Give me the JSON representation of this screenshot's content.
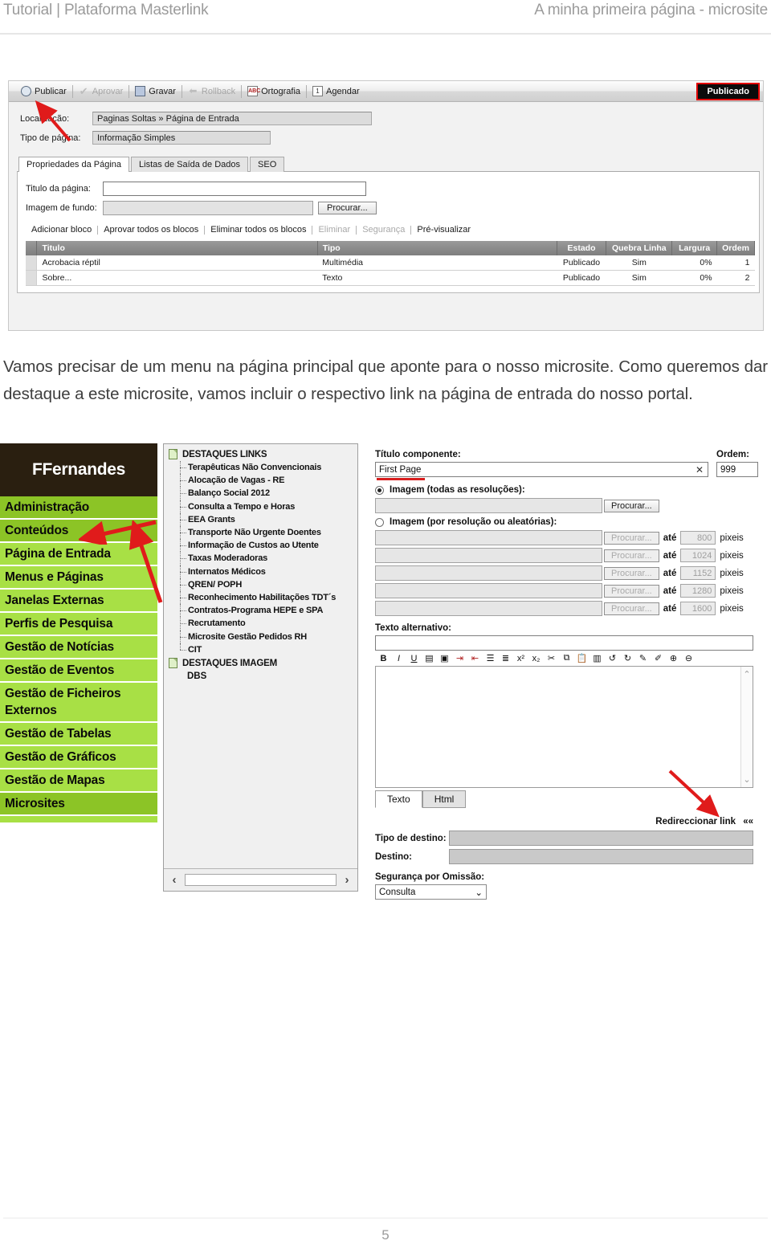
{
  "header": {
    "left": "Tutorial | Plataforma Masterlink",
    "right": "A minha primeira página - microsite"
  },
  "screenshot1": {
    "toolbar": {
      "publicar": "Publicar",
      "aprovar": "Aprovar",
      "gravar": "Gravar",
      "rollback": "Rollback",
      "ortografia": "Ortografia",
      "agendar": "Agendar",
      "status_badge": "Publicado",
      "status_badge_border": "#e20000"
    },
    "fields": {
      "localizacao_label": "Localização:",
      "localizacao_value": "Paginas Soltas » Página de Entrada",
      "tipo_pagina_label": "Tipo de página:",
      "tipo_pagina_value": "Informação Simples"
    },
    "tabs": [
      {
        "label": "Propriedades da Página",
        "active": true
      },
      {
        "label": "Listas de Saída de Dados",
        "active": false
      },
      {
        "label": "SEO",
        "active": false
      }
    ],
    "panel": {
      "titulo_label": "Titulo da página:",
      "titulo_value": "",
      "imagem_label": "Imagem de fundo:",
      "imagem_value": "",
      "procurar_label": "Procurar..."
    },
    "block_actions": [
      {
        "label": "Adicionar bloco",
        "dim": false
      },
      {
        "label": "Aprovar todos os blocos",
        "dim": false
      },
      {
        "label": "Eliminar todos os blocos",
        "dim": false
      },
      {
        "label": "Eliminar",
        "dim": true
      },
      {
        "label": "Segurança",
        "dim": true
      },
      {
        "label": "Pré-visualizar",
        "dim": false
      }
    ],
    "table": {
      "columns": [
        "Titulo",
        "Tipo",
        "Estado",
        "Quebra Linha",
        "Largura",
        "Ordem"
      ],
      "rows": [
        {
          "titulo": "Acrobacia réptil",
          "tipo": "Multimédia",
          "estado": "Publicado",
          "quebra": "Sim",
          "largura": "0%",
          "ordem": "1"
        },
        {
          "titulo": "Sobre...",
          "tipo": "Texto",
          "estado": "Publicado",
          "quebra": "Sim",
          "largura": "0%",
          "ordem": "2"
        }
      ]
    }
  },
  "paragraph": "Vamos precisar de um menu na página principal que aponte para o nosso microsite. Como queremos dar destaque a este microsite, vamos incluir o respectivo link na página de entrada do nosso portal.",
  "screenshot2": {
    "sidebar": {
      "user": "FFernandes",
      "header_color": "#2a1f10",
      "item_color": "#a8e045",
      "active_color": "#8cc426",
      "items": [
        {
          "label": "Administração",
          "active": true
        },
        {
          "label": "Conteúdos",
          "active": true
        },
        {
          "label": "Página de Entrada",
          "active": false
        },
        {
          "label": "Menus e Páginas",
          "active": false
        },
        {
          "label": "Janelas Externas",
          "active": false
        },
        {
          "label": "Perfis de Pesquisa",
          "active": false
        },
        {
          "label": "Gestão de Notícias",
          "active": false
        },
        {
          "label": "Gestão de Eventos",
          "active": false
        },
        {
          "label": "Gestão de Ficheiros Externos",
          "active": false
        },
        {
          "label": "Gestão de Tabelas",
          "active": false
        },
        {
          "label": "Gestão de Gráficos",
          "active": false
        },
        {
          "label": "Gestão de Mapas",
          "active": false
        },
        {
          "label": "Microsites",
          "active": true
        }
      ]
    },
    "tree": {
      "root": "DESTAQUES LINKS",
      "children": [
        "Terapêuticas Não Convencionais",
        "Alocação de Vagas - RE",
        "Balanço Social 2012",
        "Consulta a Tempo e Horas",
        "EEA Grants",
        "Transporte Não Urgente Doentes",
        "Informação de Custos ao Utente",
        "Taxas Moderadoras",
        "Internatos Médicos",
        "QREN/ POPH",
        "Reconhecimento Habilitações TDT´s",
        "Contratos-Programa HEPE e SPA",
        "Recrutamento",
        "Microsite Gestão Pedidos RH",
        "CIT"
      ],
      "root2": "DESTAQUES IMAGEM",
      "extra": "DBS",
      "scroll_prev": "‹",
      "scroll_next": "›"
    },
    "form": {
      "titulo_componente_label": "Título componente:",
      "titulo_componente_value": "First Page",
      "clear_icon": "✕",
      "ordem_label": "Ordem:",
      "ordem_value": "999",
      "radio_all_label": "Imagem (todas as resoluções):",
      "radio_res_label": "Imagem (por resolução ou aleatórias):",
      "procurar_label": "Procurar...",
      "ate_label": "até",
      "pixeis_label": "pixeis",
      "resolutions": [
        "800",
        "1024",
        "1152",
        "1280",
        "1600"
      ],
      "texto_alternativo_label": "Texto alternativo:",
      "texto_alternativo_value": "",
      "editor_tabs": [
        {
          "label": "Texto",
          "active": true
        },
        {
          "label": "Html",
          "active": false
        }
      ],
      "editor_icons": [
        "bold-icon",
        "italic-icon",
        "underline-icon",
        "align-icon",
        "image-icon",
        "indent-increase-icon",
        "indent-decrease-icon",
        "bullet-list-icon",
        "numbered-list-icon",
        "superscript-icon",
        "subscript-icon",
        "cut-icon",
        "copy-icon",
        "paste-icon",
        "paste-plain-icon",
        "undo-icon",
        "redo-icon",
        "edit-icon",
        "edit-alt-icon",
        "zoom-in-icon",
        "zoom-out-icon"
      ],
      "redireccionar_link": "Redireccionar link",
      "redireccionar_chevrons": "««",
      "tipo_destino_label": "Tipo de destino:",
      "tipo_destino_value": "",
      "destino_label": "Destino:",
      "destino_value": "",
      "seguranca_label": "Segurança por Omissão:",
      "seguranca_value": "Consulta"
    }
  },
  "footer": {
    "page_number": "5"
  }
}
